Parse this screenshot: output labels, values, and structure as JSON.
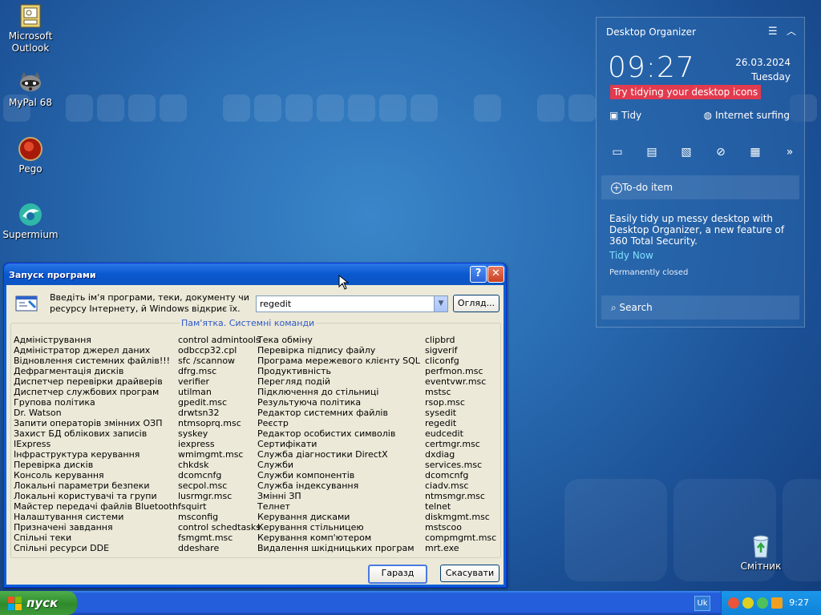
{
  "desktop": {
    "icons": [
      {
        "label": "Microsoft\nOutlook"
      },
      {
        "label": "MyPal 68"
      },
      {
        "label": "Pego"
      },
      {
        "label": "Supermium"
      },
      {
        "label": "Смітник"
      }
    ]
  },
  "organizer": {
    "title": "Desktop Organizer",
    "time": "09:27",
    "date": "26.03.2024",
    "day": "Tuesday",
    "tip": "Try tidying your desktop icons",
    "tidy_label": "Tidy",
    "internet_label": "Internet surfing",
    "todo_label": "To-do item",
    "description": "Easily tidy up messy desktop with Desktop Organizer, a new feature of 360 Total Security.",
    "tidy_now": "Tidy Now",
    "permanently_closed": "Permanently closed",
    "search_placeholder": "Search"
  },
  "run_dialog": {
    "title": "Запуск програми",
    "prompt": "Введіть ім'я програми, теки, документу чи ресурсу Інтернету, й Windows відкриє їх.",
    "input_value": "regedit",
    "browse_label": "Огляд...",
    "group_label": "Пам'ятка. Системні команди",
    "ok_label": "Гаразд",
    "cancel_label": "Скасувати",
    "col1": [
      "Адміністрування",
      "Адміністратор джерел даних",
      "Відновлення системних файлів!!!",
      "Дефрагментація дисків",
      "Диспетчер перевірки драйверів",
      "Диспетчер службових програм",
      "Групова політика",
      "Dr. Watson",
      "Запити операторів змінних ОЗП",
      "Захист БД облікових записів",
      "IExpress",
      "Інфраструктура керування",
      "Перевірка дисків",
      "Консоль керування",
      "Локальні параметри безпеки",
      "Локальні користувачі та групи",
      "Майстер передачі файлів Bluetooth",
      "Налаштування системи",
      "Призначені завдання",
      "Спільні теки",
      "Спільні ресурси DDE"
    ],
    "col2": [
      "control admintools",
      "odbccp32.cpl",
      "sfc /scannow",
      "dfrg.msc",
      "verifier",
      "utilman",
      "gpedit.msc",
      "drwtsn32",
      "ntmsoprq.msc",
      "syskey",
      "iexpress",
      "wmimgmt.msc",
      "chkdsk",
      "dcomcnfg",
      "secpol.msc",
      "lusrmgr.msc",
      "fsquirt",
      "msconfig",
      "control schedtasks",
      "fsmgmt.msc",
      "ddeshare"
    ],
    "col3": [
      "Тека обміну",
      "Перевірка підпису файлу",
      "Програма мережевого клієнту SQL",
      "Продуктивність",
      "Перегляд подій",
      "Підключення до стільниці",
      "Результуюча політика",
      "Редактор системних файлів",
      "Реєстр",
      "Редактор особистих символів",
      "Сертифікати",
      "Служба діагностики DirectX",
      "Служби",
      "Служби компонентів",
      "Служба індексування",
      "Змінні ЗП",
      "Телнет",
      "Керування дисками",
      "Керування стільницею",
      "Керування комп'ютером",
      "Видалення шкідницьких програм"
    ],
    "col4": [
      "clipbrd",
      "sigverif",
      "cliconfg",
      "perfmon.msc",
      "eventvwr.msc",
      "mstsc",
      "rsop.msc",
      "sysedit",
      "regedit",
      "eudcedit",
      "certmgr.msc",
      "dxdiag",
      "services.msc",
      "dcomcnfg",
      "ciadv.msc",
      "ntmsmgr.msc",
      "telnet",
      "diskmgmt.msc",
      "mstscoo",
      "compmgmt.msc",
      "mrt.exe"
    ]
  },
  "taskbar": {
    "start_label": "пуск",
    "lang": "Uk",
    "clock": "9:27"
  }
}
